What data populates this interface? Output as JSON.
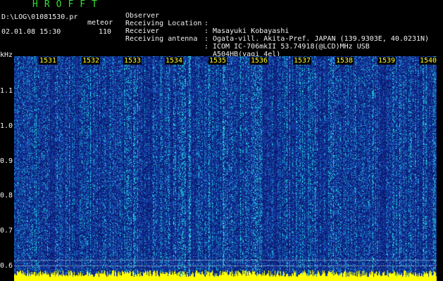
{
  "header": {
    "app_name": "HROFFT",
    "log_path": "D:\\LOG\\01081530.pr",
    "mode": "meteor",
    "datetime": "02.01.08 15:30",
    "count": "110"
  },
  "station_info": [
    {
      "label": "Observer",
      "value": "Masayuki Kobayashi"
    },
    {
      "label": "Receiving Location",
      "value": "Ogata-vill. Akita-Pref. JAPAN (139.9303E, 40.0231N)"
    },
    {
      "label": "Receiver",
      "value": "ICOM IC-706mkII 53.74918(@LCD)MHz USB"
    },
    {
      "label": "Receiving antenna",
      "value": "A504HB(yagi 4el)"
    }
  ],
  "info_colon": ":",
  "y_axis": {
    "unit": "kHz",
    "ticks": [
      "1.1",
      "1.0",
      "0.9",
      "0.8",
      "0.7",
      "0.6"
    ]
  },
  "time_axis": {
    "labels": [
      "1531",
      "1532",
      "1533",
      "1534",
      "1535",
      "1536",
      "1537",
      "1538",
      "1539",
      "1540"
    ]
  },
  "colors": {
    "background": "#000000",
    "title": "#2fe02f",
    "text": "#f2f2f2",
    "time_labels": "#ffff33",
    "signal_low": "#1830a0",
    "signal_high": "#00ffff",
    "baseline": "#ffff00"
  }
}
